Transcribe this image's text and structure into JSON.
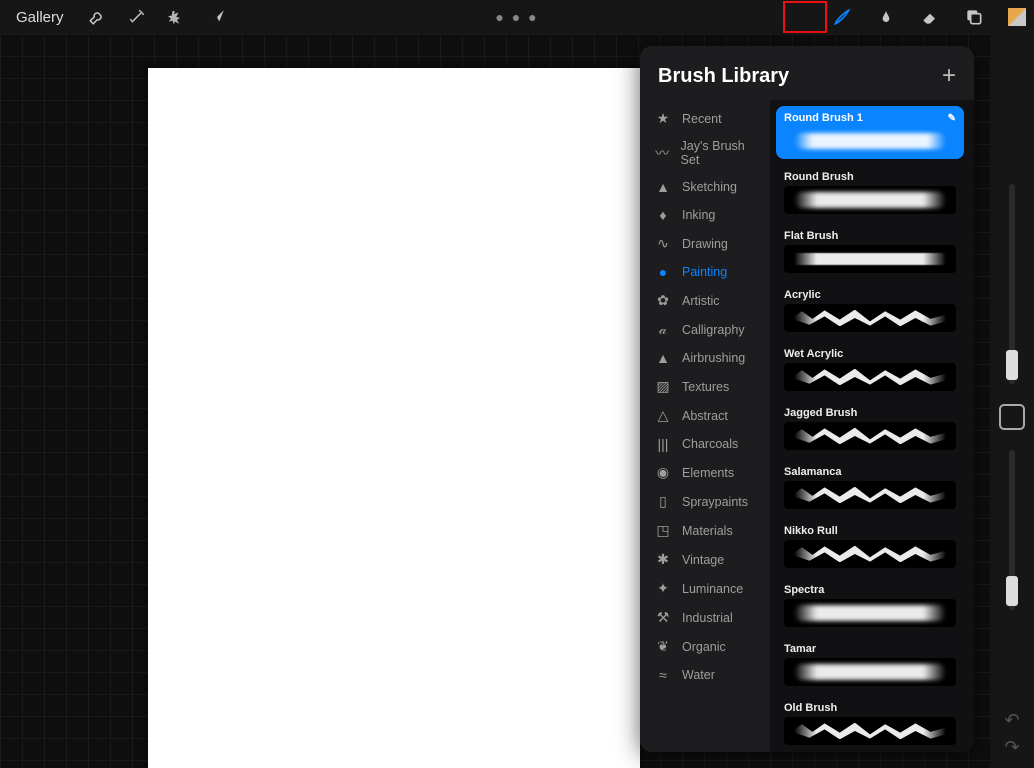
{
  "topbar": {
    "gallery": "Gallery",
    "left_tools": [
      {
        "name": "wrench-icon"
      },
      {
        "name": "wand-icon"
      },
      {
        "name": "select-icon"
      },
      {
        "name": "arrow-icon"
      }
    ],
    "right_tools": [
      {
        "name": "brush-icon",
        "highlighted": true
      },
      {
        "name": "smudge-icon"
      },
      {
        "name": "eraser-icon"
      },
      {
        "name": "layers-icon"
      },
      {
        "name": "color-icon"
      }
    ]
  },
  "panel": {
    "title": "Brush Library",
    "categories": [
      {
        "icon": "★",
        "label": "Recent"
      },
      {
        "icon": "〰",
        "label": "Jay's Brush Set"
      },
      {
        "icon": "▲",
        "label": "Sketching"
      },
      {
        "icon": "♦",
        "label": "Inking"
      },
      {
        "icon": "∿",
        "label": "Drawing"
      },
      {
        "icon": "●",
        "label": "Painting",
        "active": true
      },
      {
        "icon": "✿",
        "label": "Artistic"
      },
      {
        "icon": "𝒶",
        "label": "Calligraphy"
      },
      {
        "icon": "▲",
        "label": "Airbrushing"
      },
      {
        "icon": "▨",
        "label": "Textures"
      },
      {
        "icon": "△",
        "label": "Abstract"
      },
      {
        "icon": "|||",
        "label": "Charcoals"
      },
      {
        "icon": "◉",
        "label": "Elements"
      },
      {
        "icon": "▯",
        "label": "Spraypaints"
      },
      {
        "icon": "◳",
        "label": "Materials"
      },
      {
        "icon": "✱",
        "label": "Vintage"
      },
      {
        "icon": "✦",
        "label": "Luminance"
      },
      {
        "icon": "⚒",
        "label": "Industrial"
      },
      {
        "icon": "❦",
        "label": "Organic"
      },
      {
        "icon": "≈",
        "label": "Water"
      }
    ],
    "brushes": [
      {
        "name": "Round Brush 1",
        "selected": true,
        "style": "soft"
      },
      {
        "name": "Round Brush",
        "style": "soft"
      },
      {
        "name": "Flat Brush",
        "style": "flat"
      },
      {
        "name": "Acrylic",
        "style": "rough"
      },
      {
        "name": "Wet Acrylic",
        "style": "rough"
      },
      {
        "name": "Jagged Brush",
        "style": "rough"
      },
      {
        "name": "Salamanca",
        "style": "rough"
      },
      {
        "name": "Nikko Rull",
        "style": "rough"
      },
      {
        "name": "Spectra",
        "style": "soft"
      },
      {
        "name": "Tamar",
        "style": "soft"
      },
      {
        "name": "Old Brush",
        "style": "rough"
      }
    ]
  },
  "colors": {
    "accent": "#0a84ff"
  }
}
